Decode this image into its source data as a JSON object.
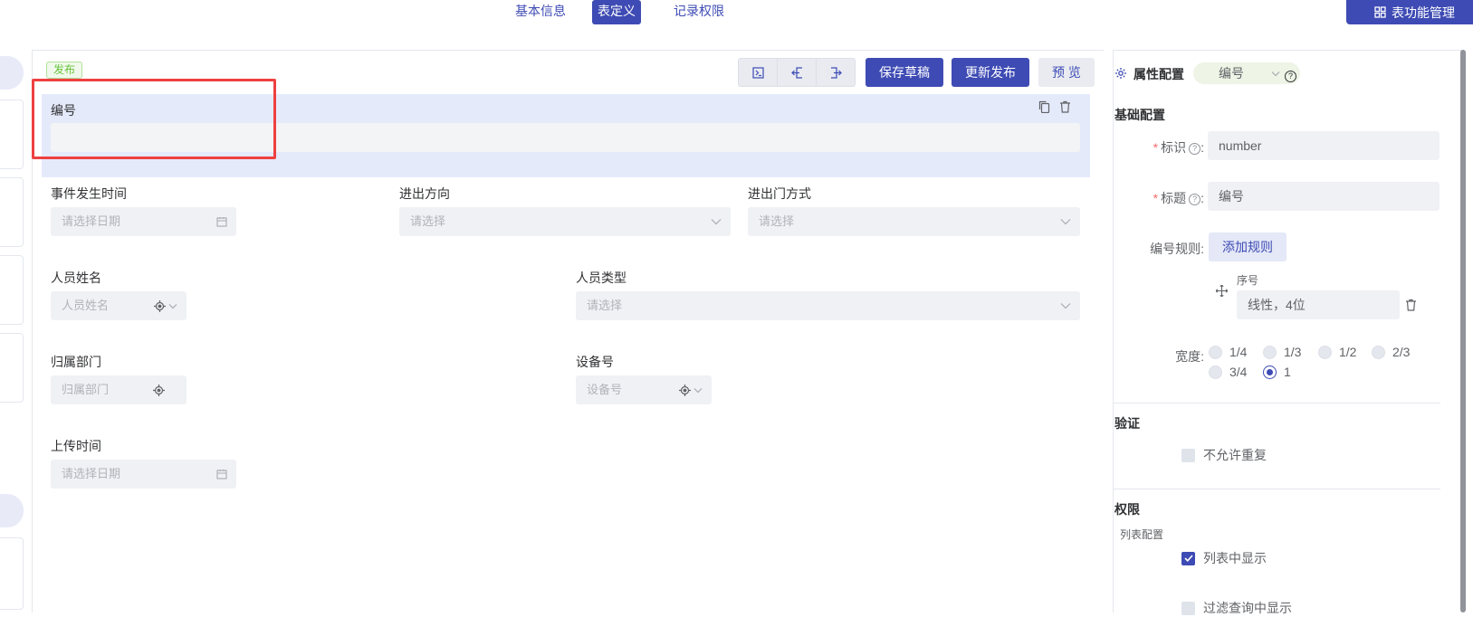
{
  "tabs": [
    {
      "label": "基本信息"
    },
    {
      "label": "表定义"
    },
    {
      "label": "记录权限"
    }
  ],
  "manage_button": {
    "label": "表功能管理",
    "icon": "grid-icon"
  },
  "canvas": {
    "publish_badge": "发布",
    "toolbar": {
      "icon_buttons": [
        "terminal-icon",
        "import-icon",
        "export-icon"
      ],
      "save_draft": "保存草稿",
      "republish": "更新发布",
      "preview": "预 览"
    },
    "selected_field": {
      "label": "编号",
      "value": ""
    },
    "fields": [
      {
        "label": "事件发生时间",
        "placeholder": "请选择日期",
        "suffix": "calendar-icon"
      },
      {
        "label": "进出方向",
        "placeholder": "请选择",
        "suffix": "chevron-down-icon"
      },
      {
        "label": "进出门方式",
        "placeholder": "请选择",
        "suffix": "chevron-down-icon"
      },
      {
        "label": "人员姓名",
        "placeholder": "人员姓名",
        "suffix": "locate-icon"
      },
      {
        "label": "人员类型",
        "placeholder": "请选择",
        "suffix": "chevron-down-icon"
      },
      {
        "label": "归属部门",
        "placeholder": "归属部门",
        "suffix": "locate-icon"
      },
      {
        "label": "设备号",
        "placeholder": "设备号",
        "suffix": "locate-icon"
      },
      {
        "label": "上传时间",
        "placeholder": "请选择日期",
        "suffix": "calendar-icon"
      }
    ]
  },
  "panel": {
    "title": "属性配置",
    "field_select": "编号",
    "basic_section": "基础配置",
    "id_label": "标识",
    "id_value": "number",
    "title_label": "标题",
    "title_value": "编号",
    "rule_label": "编号规则:",
    "add_rule": "添加规则",
    "rule_item_label": "序号",
    "rule_item_value": "线性，4位",
    "width_label": "宽度:",
    "width_options": [
      "1/4",
      "1/3",
      "1/2",
      "2/3",
      "3/4",
      "1"
    ],
    "width_selected": "1",
    "validation_section": "验证",
    "no_duplicate": "不允许重复",
    "no_duplicate_checked": false,
    "permission_section": "权限",
    "list_config": "列表配置",
    "show_in_list": "列表中显示",
    "show_in_list_checked": true,
    "show_in_filter": "过滤查询中显示",
    "show_in_filter_checked": false
  },
  "colors": {
    "accent": "#3e4bb4",
    "selected_bg": "#e5eafa",
    "highlight": "#ee4040"
  }
}
